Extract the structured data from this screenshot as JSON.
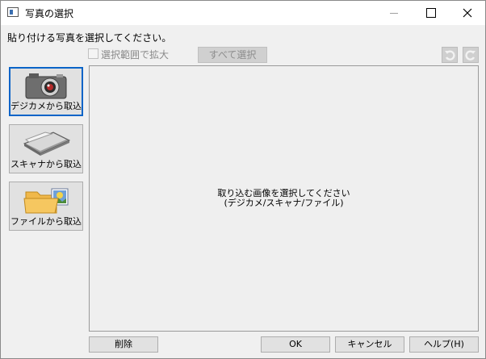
{
  "window": {
    "title": "写真の選択"
  },
  "instruction": "貼り付ける写真を選択してください。",
  "toolbar": {
    "zoom_checkbox_label": "選択範囲で拡大",
    "zoom_checked": false,
    "select_all_label": "すべて選択"
  },
  "sources": [
    {
      "label": "デジカメから取込",
      "icon": "camera-icon"
    },
    {
      "label": "スキャナから取込",
      "icon": "scanner-icon"
    },
    {
      "label": "ファイルから取込",
      "icon": "folder-picture-icon"
    }
  ],
  "preview": {
    "message_line1": "取り込む画像を選択してください",
    "message_line2": "(デジカメ/スキャナ/ファイル)"
  },
  "buttons": {
    "delete": "削除",
    "ok": "OK",
    "cancel": "キャンセル",
    "help": "ヘルプ(H)"
  },
  "colors": {
    "focus_border": "#0a64c8",
    "dialog_bg": "#f0f0f0"
  }
}
